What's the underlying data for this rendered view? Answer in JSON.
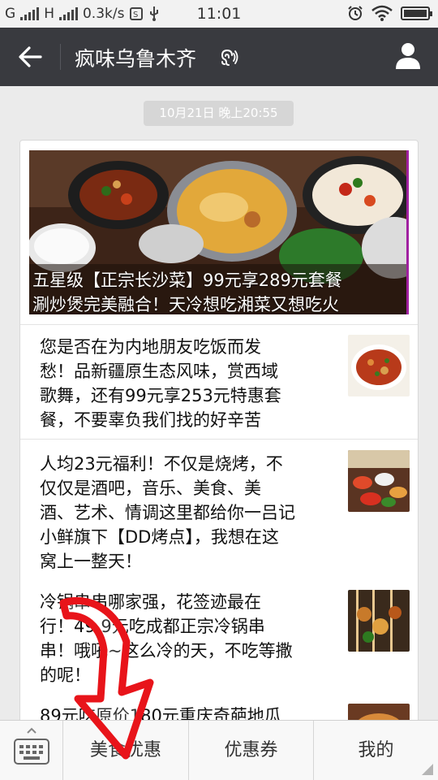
{
  "status_bar": {
    "sim1": "G",
    "sim2": "H",
    "speed": "0.3k/s",
    "time": "11:01",
    "icons": [
      "alarm-icon",
      "wifi-icon",
      "battery-icon",
      "usb-icon",
      "sim-card-icon"
    ]
  },
  "header": {
    "title": "疯味乌鲁木齐",
    "back_icon": "back-arrow-icon",
    "listen_icon": "ear-icon",
    "profile_icon": "person-icon"
  },
  "date_label": "10月21日 晚上20:55",
  "hero": {
    "caption_line1": "五星级【正宗长沙菜】99元享289元套餐",
    "caption_line2": "涮炒煲完美融合！天冷想吃湘菜又想吃火"
  },
  "articles": [
    {
      "lines": [
        "您是否在为内地朋友吃饭而发",
        "愁！品新疆原生态风味，赏西域",
        "歌舞，还有99元享253元特惠套",
        "餐，不要辜负我们找的好辛苦"
      ]
    },
    {
      "lines": [
        "人均23元福利！不仅是烧烤，不",
        "仅仅是酒吧，音乐、美食、美",
        "酒、艺术、情调这里都给你一吕记",
        "小鲜旗下【DD烤点】，我想在这",
        "窝上一整天！"
      ]
    },
    {
      "lines": [
        "冷锅串串哪家强，花签迹最在",
        "行！49.9元吃成都正宗冷锅串",
        "串！哦吼~这么冷的天，不吃等撒",
        "的呢！"
      ]
    },
    {
      "lines": [
        "89元吃原价180元重庆奇葩地瓜"
      ]
    }
  ],
  "bottom_nav": {
    "keyboard_icon": "keyboard-icon",
    "tabs": [
      "美食优惠",
      "优惠券",
      "我的"
    ]
  },
  "colors": {
    "header_bg": "#393a3f",
    "page_bg": "#ebebeb",
    "annotation_arrow": "#e8141a"
  }
}
